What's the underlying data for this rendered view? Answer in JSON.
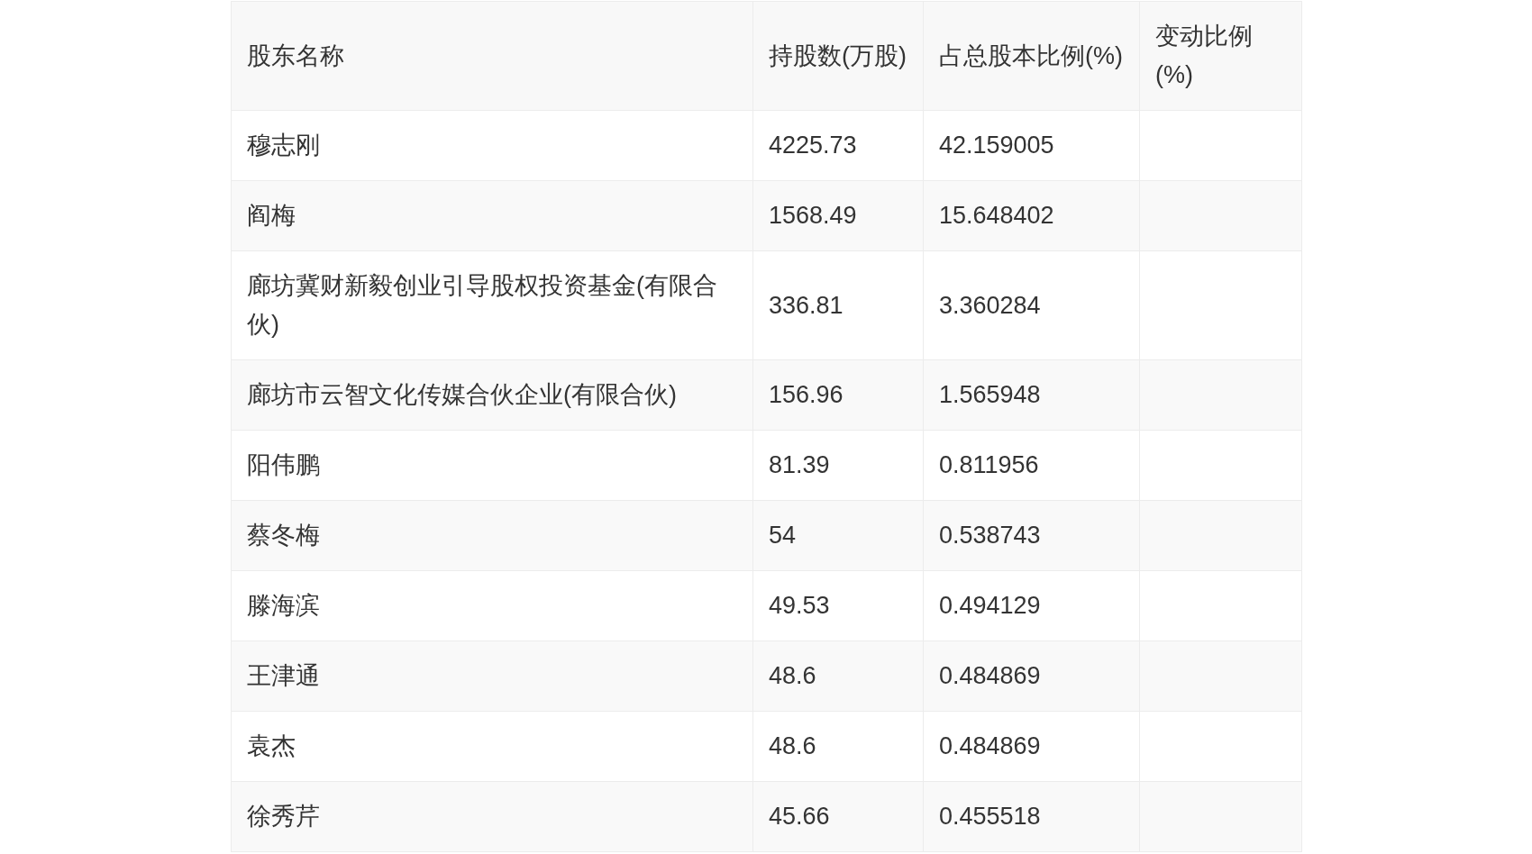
{
  "table": {
    "columns": [
      "股东名称",
      "持股数(万股)",
      "占总股本比例(%)",
      "变动比例(%)"
    ],
    "rows": [
      {
        "name": "穆志刚",
        "shares": "4225.73",
        "ratio": "42.159005"
      },
      {
        "name": "阎梅",
        "shares": "1568.49",
        "ratio": "15.648402"
      },
      {
        "name": "廊坊冀财新毅创业引导股权投资基金(有限合伙)",
        "shares": "336.81",
        "ratio": "3.360284"
      },
      {
        "name": "廊坊市云智文化传媒合伙企业(有限合伙)",
        "shares": "156.96",
        "ratio": "1.565948"
      },
      {
        "name": "阳伟鹏",
        "shares": "81.39",
        "ratio": "0.811956"
      },
      {
        "name": "蔡冬梅",
        "shares": "54",
        "ratio": "0.538743"
      },
      {
        "name": "滕海滨",
        "shares": "49.53",
        "ratio": "0.494129"
      },
      {
        "name": "王津通",
        "shares": "48.6",
        "ratio": "0.484869"
      },
      {
        "name": "袁杰",
        "shares": "48.6",
        "ratio": "0.484869"
      },
      {
        "name": "徐秀芹",
        "shares": "45.66",
        "ratio": "0.455518"
      }
    ]
  }
}
